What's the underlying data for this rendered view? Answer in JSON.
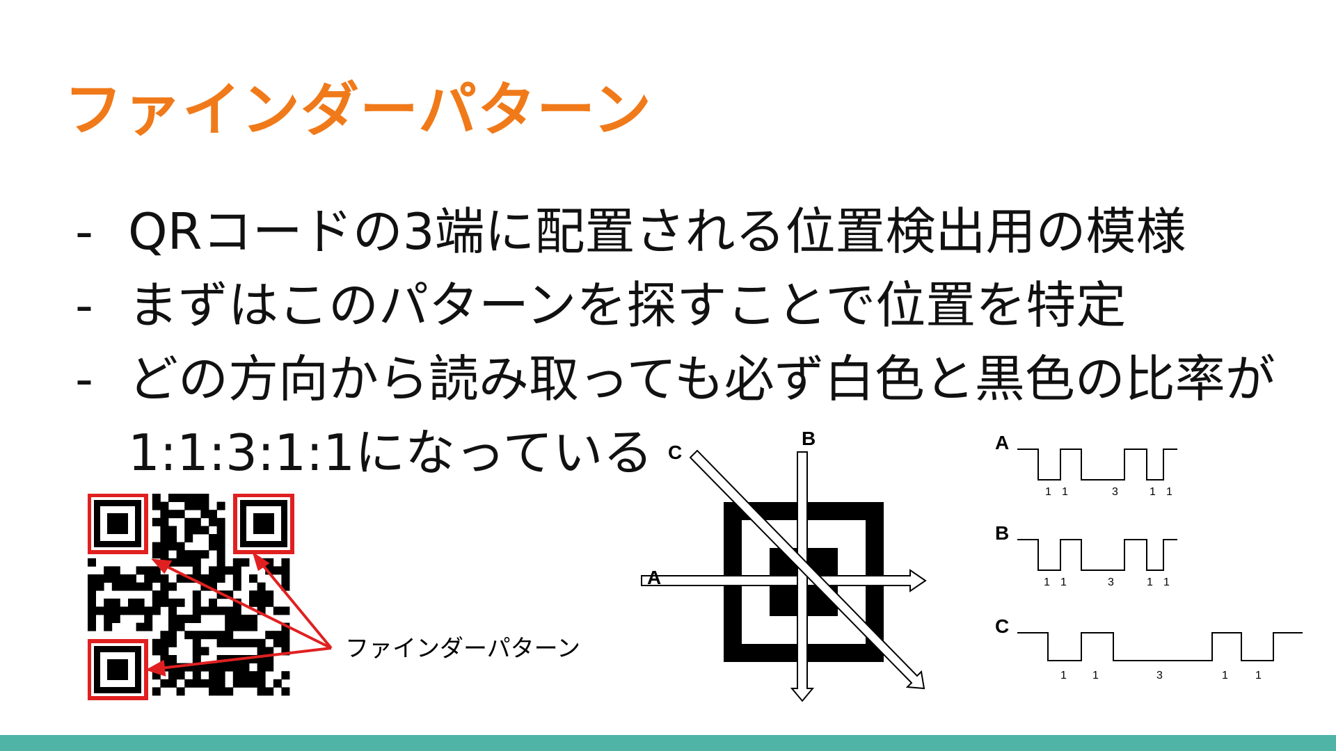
{
  "title": "ファインダーパターン",
  "bullets": [
    {
      "dash": "-",
      "text": "QRコードの3端に配置される位置検出用の模様"
    },
    {
      "dash": "-",
      "text": "まずはこのパターンを探すことで位置を特定"
    },
    {
      "dash": "-",
      "text": "どの方向から読み取っても必ず白色と黒色の比率が",
      "continuation": "1:1:3:1:1になっている"
    }
  ],
  "qr_figure": {
    "label": "ファインダーパターン",
    "highlight_color": "#e02020"
  },
  "scan_figure": {
    "labels": [
      "A",
      "B",
      "C"
    ]
  },
  "waveforms": [
    {
      "label": "A",
      "ratios": [
        "1",
        "1",
        "3",
        "1",
        "1"
      ]
    },
    {
      "label": "B",
      "ratios": [
        "1",
        "1",
        "3",
        "1",
        "1"
      ]
    },
    {
      "label": "C",
      "ratios": [
        "1",
        "1",
        "3",
        "1",
        "1"
      ]
    }
  ],
  "colors": {
    "title": "#f07a1a",
    "accent_bar": "#4fb3a6"
  }
}
